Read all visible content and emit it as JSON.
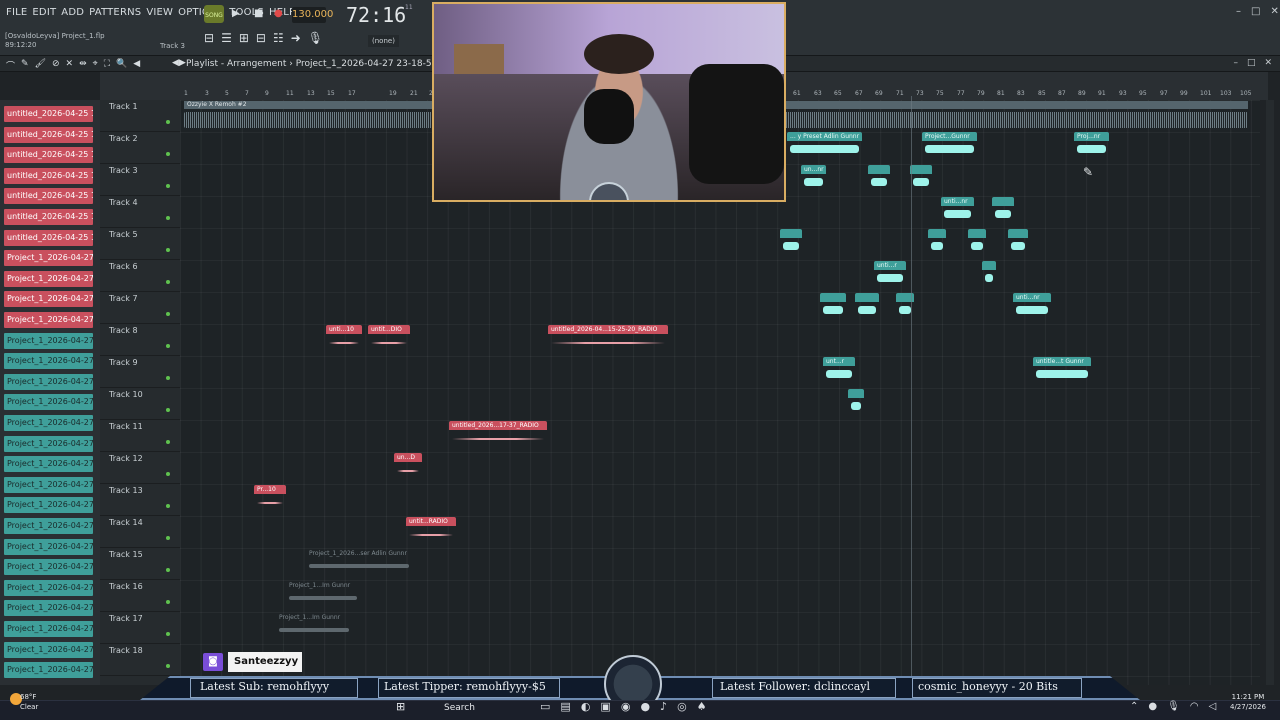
{
  "menu": [
    "FILE",
    "EDIT",
    "ADD",
    "PATTERNS",
    "VIEW",
    "OPTIONS",
    "TOOLS",
    "HELP"
  ],
  "song_toggle": "SONG",
  "tempo": "130.000",
  "time": "72:16",
  "time_small": "11",
  "time_label": "B:S:T",
  "project": {
    "user": "[OsvaldoLeyva]",
    "file": "Project_1.flp",
    "elapsed": "89:12:20"
  },
  "track_hint": "Track 3",
  "pattern": "(none)",
  "playlist_title": "Playlist - Arrangement",
  "playlist_project": "Project_1_2026-04-27 23-18-55_Ind",
  "ruler": [
    "1",
    "3",
    "5",
    "7",
    "9",
    "11",
    "13",
    "15",
    "17",
    "19",
    "21",
    "23",
    "61",
    "63",
    "65",
    "67",
    "69",
    "71",
    "73",
    "75",
    "77",
    "79",
    "81",
    "83",
    "85",
    "87",
    "89",
    "91",
    "93",
    "95",
    "97",
    "99",
    "101",
    "103",
    "105"
  ],
  "picker": [
    {
      "label": "untitled_2026-04-25 15-...",
      "color": "red"
    },
    {
      "label": "untitled_2026-04-25 15-...",
      "color": "red"
    },
    {
      "label": "untitled_2026-04-25 15-...",
      "color": "red"
    },
    {
      "label": "untitled_2026-04-25 15-...",
      "color": "red"
    },
    {
      "label": "untitled_2026-04-25 15-...",
      "color": "red"
    },
    {
      "label": "untitled_2026-04-25 15-...",
      "color": "red"
    },
    {
      "label": "untitled_2026-04-25 15-...",
      "color": "red"
    },
    {
      "label": "Project_1_2026-04-27 2...",
      "color": "red"
    },
    {
      "label": "Project_1_2026-04-27 2...",
      "color": "red"
    },
    {
      "label": "Project_1_2026-04-27 2...",
      "color": "red"
    },
    {
      "label": "Project_1_2026-04-27 2...",
      "color": "red"
    },
    {
      "label": "Project_1_2026-04-27 2...",
      "color": "teal"
    },
    {
      "label": "Project_1_2026-04-27 2...",
      "color": "teal"
    },
    {
      "label": "Project_1_2026-04-27 2...",
      "color": "teal"
    },
    {
      "label": "Project_1_2026-04-27 2...",
      "color": "teal"
    },
    {
      "label": "Project_1_2026-04-27 2...",
      "color": "teal"
    },
    {
      "label": "Project_1_2026-04-27 2...",
      "color": "teal"
    },
    {
      "label": "Project_1_2026-04-27 2...",
      "color": "teal"
    },
    {
      "label": "Project_1_2026-04-27 2...",
      "color": "teal"
    },
    {
      "label": "Project_1_2026-04-27 2...",
      "color": "teal"
    },
    {
      "label": "Project_1_2026-04-27 2...",
      "color": "teal"
    },
    {
      "label": "Project_1_2026-04-27 2...",
      "color": "teal"
    },
    {
      "label": "Project_1_2026-04-27 2...",
      "color": "teal"
    },
    {
      "label": "Project_1_2026-04-27 2...",
      "color": "teal"
    },
    {
      "label": "Project_1_2026-04-27 2...",
      "color": "teal"
    },
    {
      "label": "Project_1_2026-04-27 2...",
      "color": "teal"
    },
    {
      "label": "Project_1_2026-04-27 2...",
      "color": "teal"
    },
    {
      "label": "Project_1_2026-04-27 2...",
      "color": "teal"
    }
  ],
  "tracks": [
    "Track 1",
    "Track 2",
    "Track 3",
    "Track 4",
    "Track 5",
    "Track 6",
    "Track 7",
    "Track 8",
    "Track 9",
    "Track 10",
    "Track 11",
    "Track 12",
    "Track 13",
    "Track 14",
    "Track 15",
    "Track 16",
    "Track 17",
    "Track 18"
  ],
  "track1_clip": "Ozzyie X Remoh #2",
  "clips": {
    "t2a": "... y Preset Adlin Gunnr",
    "t2b": "Project...Gunnr",
    "t2c": "Proj...nr",
    "t3a": "un...nr",
    "t4a": "unti...nr",
    "t6a": "unti...r",
    "t7a": "unti...nr",
    "t8a": "unti...10",
    "t8b": "untit...DIO",
    "t8c": "untitled_2026-04...15-25-20_RADIO",
    "t9a": "unt...r",
    "t9b": "untitle...t Gunnr",
    "t11a": "untitled_2026...17-37_RADIO",
    "t12a": "un...D",
    "t13a": "Pr...10",
    "t14a": "untit...RADIO",
    "t15a": "Project_1_2026...ser Adlin Gunnr",
    "t16a": "Project_1...Im Gunnr",
    "t17a": "Project_1...Im Gunnr"
  },
  "stream": {
    "username": "Santeezzyy",
    "latest_sub": "Latest Sub: remohflyyy",
    "latest_tipper": "Latest Tipper: remohflyyy-$5",
    "latest_follower": "Latest Follower: dclinccayl",
    "bits": "cosmic_honeyyy - 20 Bits"
  },
  "weather": {
    "temp": "68°F",
    "cond": "Clear"
  },
  "search": "Search",
  "clock": {
    "time": "11:21 PM",
    "date": "4/27/2026"
  },
  "colors": {
    "red_clip": "#c9505e",
    "teal_clip": "#3f9f9a",
    "accent": "#e8b45a"
  }
}
